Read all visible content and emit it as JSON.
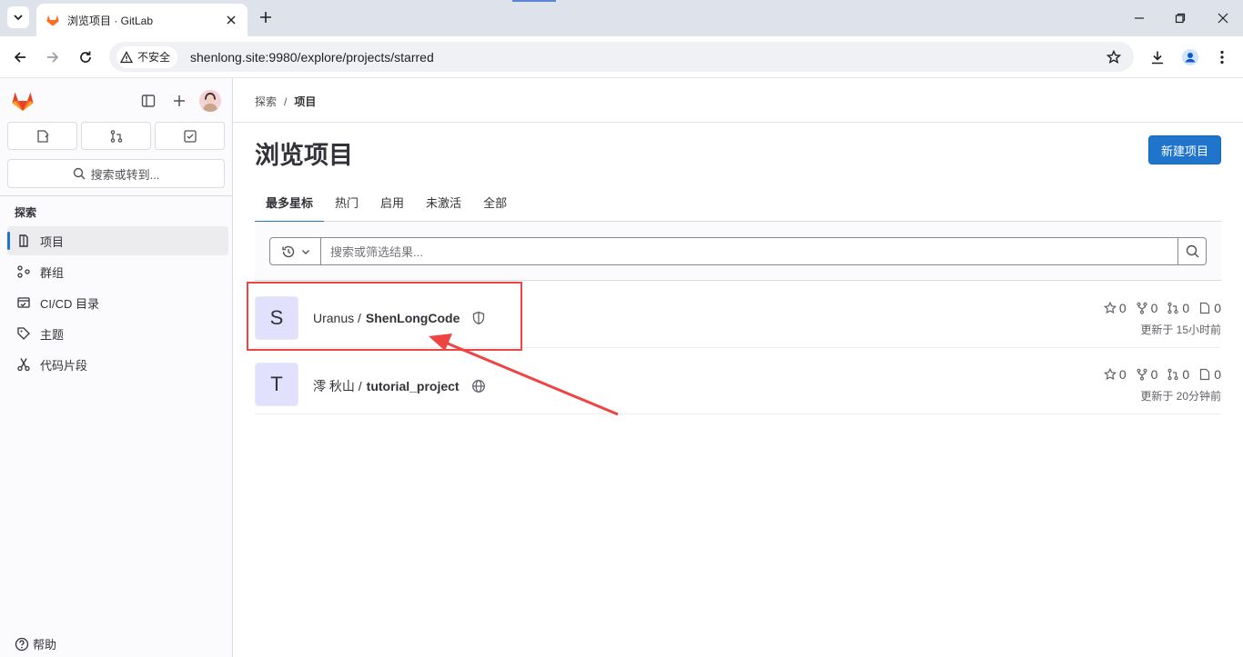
{
  "browser": {
    "tab_title": "浏览项目 · GitLab",
    "security_label": "不安全",
    "url": "shenlong.site:9980/explore/projects/starred"
  },
  "sidebar": {
    "search_placeholder": "搜索或转到...",
    "section_title": "探索",
    "items": [
      {
        "label": "项目",
        "icon": "project-icon",
        "active": true
      },
      {
        "label": "群组",
        "icon": "group-icon",
        "active": false
      },
      {
        "label": "CI/CD 目录",
        "icon": "catalog-icon",
        "active": false
      },
      {
        "label": "主题",
        "icon": "label-icon",
        "active": false
      },
      {
        "label": "代码片段",
        "icon": "snippet-icon",
        "active": false
      }
    ],
    "help_label": "帮助"
  },
  "breadcrumb": [
    "探索",
    "项目"
  ],
  "page": {
    "title": "浏览项目",
    "new_project_label": "新建项目"
  },
  "tabs": [
    "最多星标",
    "热门",
    "启用",
    "未激活",
    "全部"
  ],
  "active_tab": "最多星标",
  "filter": {
    "placeholder": "搜索或筛选结果..."
  },
  "projects": [
    {
      "avatar_letter": "S",
      "namespace": "Uranus /",
      "name": "ShenLongCode",
      "visibility_icon": "shield-icon",
      "stars": "0",
      "forks": "0",
      "merge_requests": "0",
      "issues": "0",
      "updated": "更新于 15小时前"
    },
    {
      "avatar_letter": "T",
      "namespace": "澪 秋山 /",
      "name": "tutorial_project",
      "visibility_icon": "globe-icon",
      "stars": "0",
      "forks": "0",
      "merge_requests": "0",
      "issues": "0",
      "updated": "更新于 20分钟前"
    }
  ],
  "colors": {
    "accent": "#1f75cb",
    "annotation": "#ef4444",
    "gitlab_orange": "#fc6d26"
  }
}
